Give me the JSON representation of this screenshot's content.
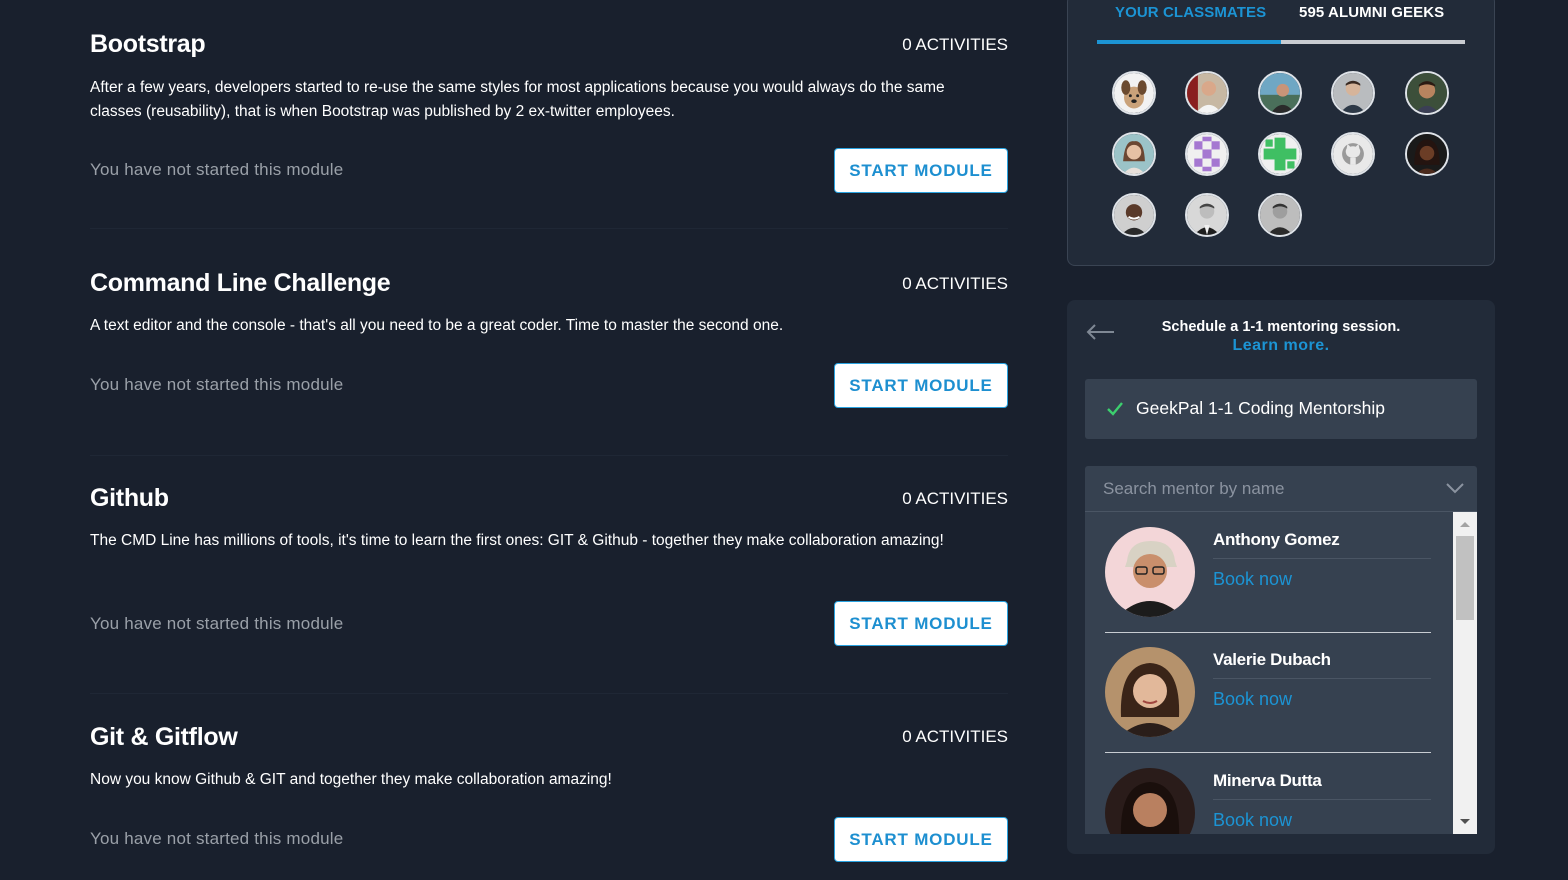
{
  "modules": [
    {
      "title": "Bootstrap",
      "activities": "0 ACTIVITIES",
      "description": "After a few years, developers started to re-use the same styles for most applications because you would always do the same classes (reusability), that is when Bootstrap was published by 2 ex-twitter employees.",
      "status": "You have not started this module",
      "button": "START MODULE"
    },
    {
      "title": "Command Line Challenge",
      "activities": "0 ACTIVITIES",
      "description": "A text editor and the console - that's all you need to be a great coder. Time to master the second one.",
      "status": "You have not started this module",
      "button": "START MODULE"
    },
    {
      "title": "Github",
      "activities": "0 ACTIVITIES",
      "description": "The CMD Line has millions of tools, it's time to learn the first ones: GIT & Github - together they make collaboration amazing!",
      "status": "You have not started this module",
      "button": "START MODULE"
    },
    {
      "title": "Git & Gitflow",
      "activities": "0 ACTIVITIES",
      "description": "Now you know Github & GIT and together they make collaboration amazing!",
      "status": "You have not started this module",
      "button": "START MODULE"
    }
  ],
  "classmates": {
    "tabs": [
      "YOUR CLASSMATES",
      "595 ALUMNI GEEKS"
    ],
    "active_tab": 0,
    "accent": "#1c94d4",
    "avatars": [
      {
        "icon": "dog-photo-avatar"
      },
      {
        "icon": "person-photo-avatar"
      },
      {
        "icon": "person-photo-avatar"
      },
      {
        "icon": "person-photo-avatar"
      },
      {
        "icon": "person-photo-avatar"
      },
      {
        "icon": "person-photo-avatar"
      },
      {
        "icon": "purple-identicon-avatar"
      },
      {
        "icon": "green-identicon-avatar"
      },
      {
        "icon": "github-default-avatar"
      },
      {
        "icon": "person-photo-avatar"
      },
      {
        "icon": "person-photo-avatar"
      },
      {
        "icon": "person-photo-avatar"
      },
      {
        "icon": "person-photo-avatar"
      }
    ]
  },
  "mentorship": {
    "schedule_text": "Schedule a 1-1 mentoring session.",
    "learn_more": "Learn more.",
    "program": "GeekPal 1-1 Coding Mentorship",
    "search_placeholder": "Search mentor by name",
    "mentors": [
      {
        "name": "Anthony Gomez",
        "action": "Book now"
      },
      {
        "name": "Valerie Dubach",
        "action": "Book now"
      },
      {
        "name": "Minerva Dutta",
        "action": "Book now"
      }
    ]
  }
}
